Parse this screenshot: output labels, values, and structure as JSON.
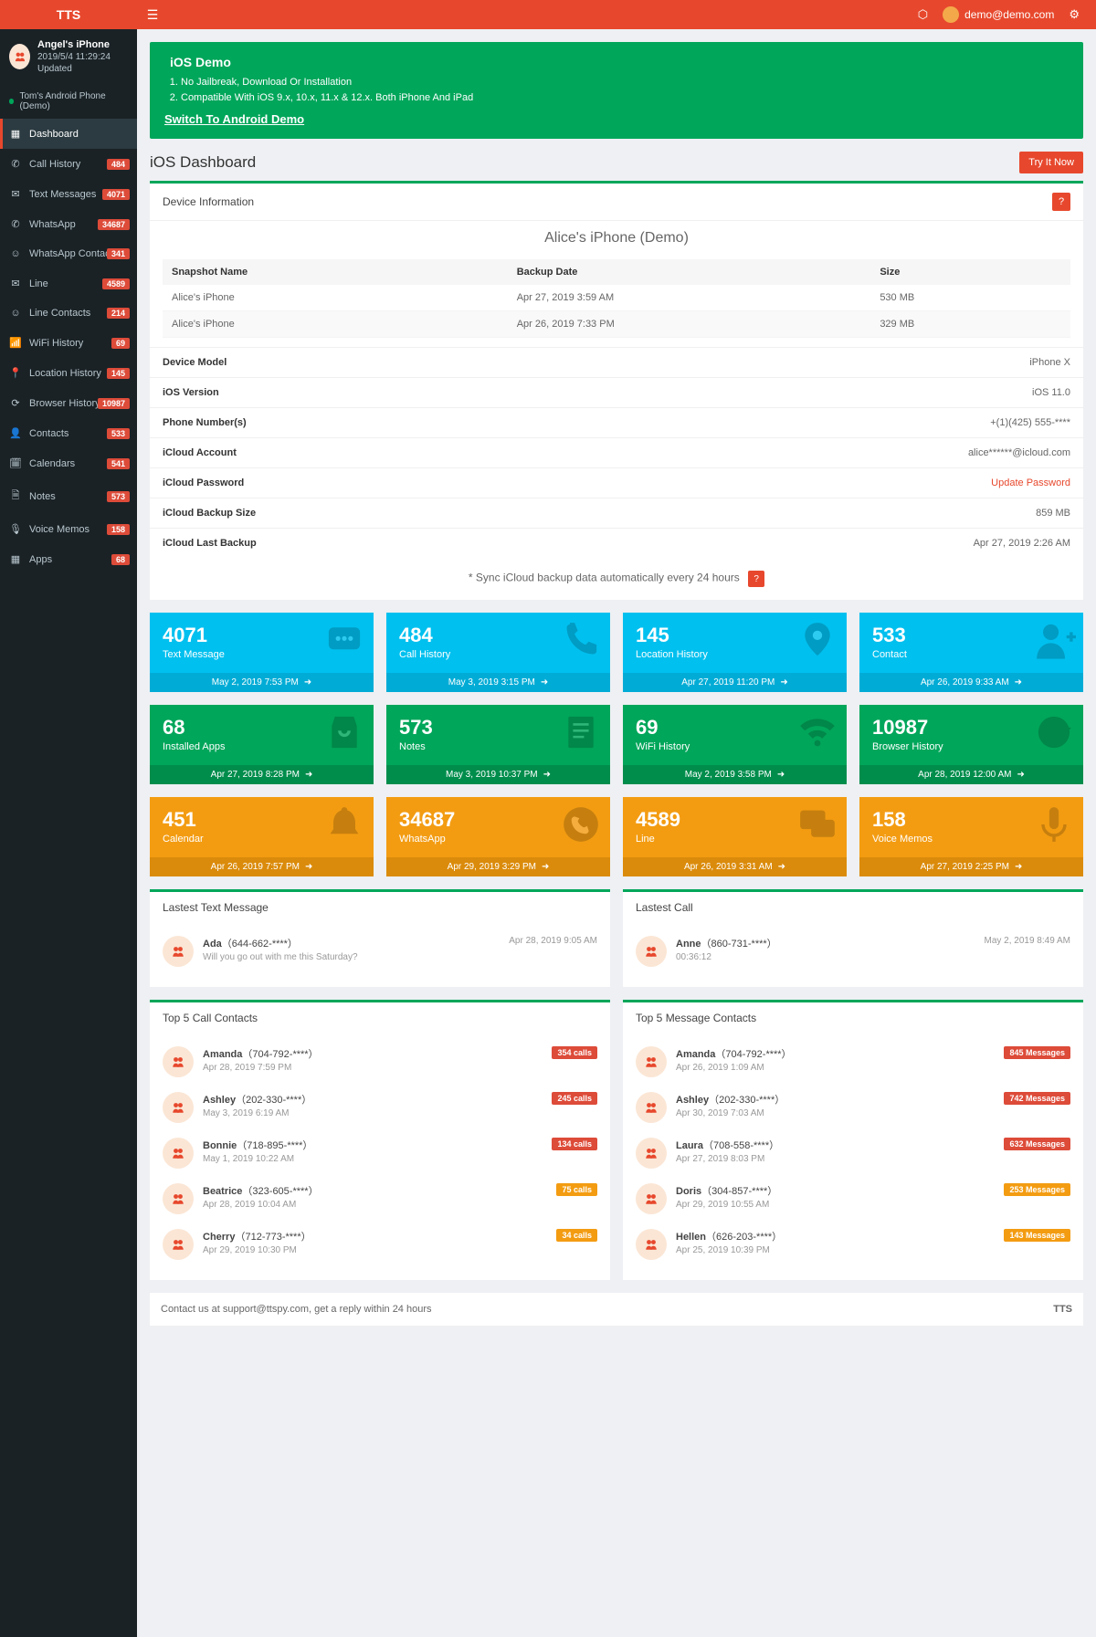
{
  "brand": "TTS",
  "topbar": {
    "email": "demo@demo.com"
  },
  "profile": {
    "name": "Angel's iPhone",
    "updated": "2019/5/4 11:29:24 Updated"
  },
  "demoSwitch": "Tom's Android Phone (Demo)",
  "nav": [
    {
      "icon": "▦",
      "label": "Dashboard",
      "badge": "",
      "active": true
    },
    {
      "icon": "✆",
      "label": "Call History",
      "badge": "484"
    },
    {
      "icon": "✉",
      "label": "Text Messages",
      "badge": "4071"
    },
    {
      "icon": "✆",
      "label": "WhatsApp",
      "badge": "34687"
    },
    {
      "icon": "☺",
      "label": "WhatsApp Contacts",
      "badge": "341"
    },
    {
      "icon": "✉",
      "label": "Line",
      "badge": "4589"
    },
    {
      "icon": "☺",
      "label": "Line Contacts",
      "badge": "214"
    },
    {
      "icon": "📶",
      "label": "WiFi History",
      "badge": "69"
    },
    {
      "icon": "📍",
      "label": "Location History",
      "badge": "145"
    },
    {
      "icon": "⟳",
      "label": "Browser History",
      "badge": "10987"
    },
    {
      "icon": "👤",
      "label": "Contacts",
      "badge": "533"
    },
    {
      "icon": "🗓",
      "label": "Calendars",
      "badge": "541"
    },
    {
      "icon": "🗎",
      "label": "Notes",
      "badge": "573"
    },
    {
      "icon": "🎙",
      "label": "Voice Memos",
      "badge": "158"
    },
    {
      "icon": "▦",
      "label": "Apps",
      "badge": "68"
    }
  ],
  "banner": {
    "title": "iOS Demo",
    "lines": [
      "No Jailbreak, Download Or Installation",
      "Compatible With iOS 9.x, 10.x, 11.x & 12.x. Both iPhone And iPad"
    ],
    "switch": "Switch To Android Demo"
  },
  "pageTitle": "iOS Dashboard",
  "tryBtn": "Try It Now",
  "devInfo": {
    "header": "Device Information",
    "deviceName": "Alice's iPhone (Demo)",
    "cols": {
      "c1": "Snapshot Name",
      "c2": "Backup Date",
      "c3": "Size"
    },
    "snapshots": [
      {
        "name": "Alice's iPhone",
        "date": "Apr 27, 2019 3:59 AM",
        "size": "530 MB"
      },
      {
        "name": "Alice's iPhone",
        "date": "Apr 26, 2019 7:33 PM",
        "size": "329 MB"
      }
    ],
    "rows": [
      {
        "k": "Device Model",
        "v": "iPhone X"
      },
      {
        "k": "iOS Version",
        "v": "iOS 11.0"
      },
      {
        "k": "Phone Number(s)",
        "v": "+(1)(425) 555-****"
      },
      {
        "k": "iCloud Account",
        "v": "alice******@icloud.com"
      },
      {
        "k": "iCloud Password",
        "v": "Update Password",
        "pw": true
      },
      {
        "k": "iCloud Backup Size",
        "v": "859 MB"
      },
      {
        "k": "iCloud Last Backup",
        "v": "Apr 27, 2019 2:26 AM"
      }
    ],
    "syncNote": "* Sync iCloud backup data automatically every 24 hours"
  },
  "tiles": [
    {
      "num": "4071",
      "label": "Text Message",
      "ts": "May 2, 2019 7:53 PM",
      "color": "blue",
      "icon": "msg"
    },
    {
      "num": "484",
      "label": "Call History",
      "ts": "May 3, 2019 3:15 PM",
      "color": "blue",
      "icon": "phone"
    },
    {
      "num": "145",
      "label": "Location History",
      "ts": "Apr 27, 2019 11:20 PM",
      "color": "blue",
      "icon": "pin"
    },
    {
      "num": "533",
      "label": "Contact",
      "ts": "Apr 26, 2019 9:33 AM",
      "color": "blue",
      "icon": "user"
    },
    {
      "num": "68",
      "label": "Installed Apps",
      "ts": "Apr 27, 2019 8:28 PM",
      "color": "green",
      "icon": "bag"
    },
    {
      "num": "573",
      "label": "Notes",
      "ts": "May 3, 2019 10:37 PM",
      "color": "green",
      "icon": "note"
    },
    {
      "num": "69",
      "label": "WiFi History",
      "ts": "May 2, 2019 3:58 PM",
      "color": "green",
      "icon": "wifi"
    },
    {
      "num": "10987",
      "label": "Browser History",
      "ts": "Apr 28, 2019 12:00 AM",
      "color": "green",
      "icon": "refresh"
    },
    {
      "num": "451",
      "label": "Calendar",
      "ts": "Apr 26, 2019 7:57 PM",
      "color": "orange",
      "icon": "bell"
    },
    {
      "num": "34687",
      "label": "WhatsApp",
      "ts": "Apr 29, 2019 3:29 PM",
      "color": "orange",
      "icon": "wa"
    },
    {
      "num": "4589",
      "label": "Line",
      "ts": "Apr 26, 2019 3:31 AM",
      "color": "orange",
      "icon": "chat"
    },
    {
      "num": "158",
      "label": "Voice Memos",
      "ts": "Apr 27, 2019 2:25 PM",
      "color": "orange",
      "icon": "mic"
    }
  ],
  "latestText": {
    "title": "Lastest Text Message",
    "name": "Ada",
    "phone": "（644-662-****）",
    "msg": "Will you go out with me this Saturday?",
    "ts": "Apr 28, 2019 9:05 AM"
  },
  "latestCall": {
    "title": "Lastest Call",
    "name": "Anne",
    "phone": "（860-731-****）",
    "dur": "00:36:12",
    "ts": "May 2, 2019 8:49 AM"
  },
  "topCalls": {
    "title": "Top 5 Call Contacts",
    "items": [
      {
        "name": "Amanda",
        "phone": "（704-792-****）",
        "sub": "Apr 28, 2019 7:59 PM",
        "tag": "354 calls",
        "tc": "red"
      },
      {
        "name": "Ashley",
        "phone": "（202-330-****）",
        "sub": "May 3, 2019 6:19 AM",
        "tag": "245 calls",
        "tc": "red"
      },
      {
        "name": "Bonnie",
        "phone": "（718-895-****）",
        "sub": "May 1, 2019 10:22 AM",
        "tag": "134 calls",
        "tc": "red"
      },
      {
        "name": "Beatrice",
        "phone": "（323-605-****）",
        "sub": "Apr 28, 2019 10:04 AM",
        "tag": "75 calls",
        "tc": "orange"
      },
      {
        "name": "Cherry",
        "phone": "（712-773-****）",
        "sub": "Apr 29, 2019 10:30 PM",
        "tag": "34 calls",
        "tc": "orange"
      }
    ]
  },
  "topMsgs": {
    "title": "Top 5 Message Contacts",
    "items": [
      {
        "name": "Amanda",
        "phone": "（704-792-****）",
        "sub": "Apr 26, 2019 1:09 AM",
        "tag": "845 Messages",
        "tc": "red"
      },
      {
        "name": "Ashley",
        "phone": "（202-330-****）",
        "sub": "Apr 30, 2019 7:03 AM",
        "tag": "742 Messages",
        "tc": "red"
      },
      {
        "name": "Laura",
        "phone": "（708-558-****）",
        "sub": "Apr 27, 2019 8:03 PM",
        "tag": "632 Messages",
        "tc": "red"
      },
      {
        "name": "Doris",
        "phone": "（304-857-****）",
        "sub": "Apr 29, 2019 10:55 AM",
        "tag": "253 Messages",
        "tc": "orange"
      },
      {
        "name": "Hellen",
        "phone": "（626-203-****）",
        "sub": "Apr 25, 2019 10:39 PM",
        "tag": "143 Messages",
        "tc": "orange"
      }
    ]
  },
  "footer": {
    "l": "Contact us at support@ttspy.com, get a reply within 24 hours",
    "r": "TTS"
  }
}
